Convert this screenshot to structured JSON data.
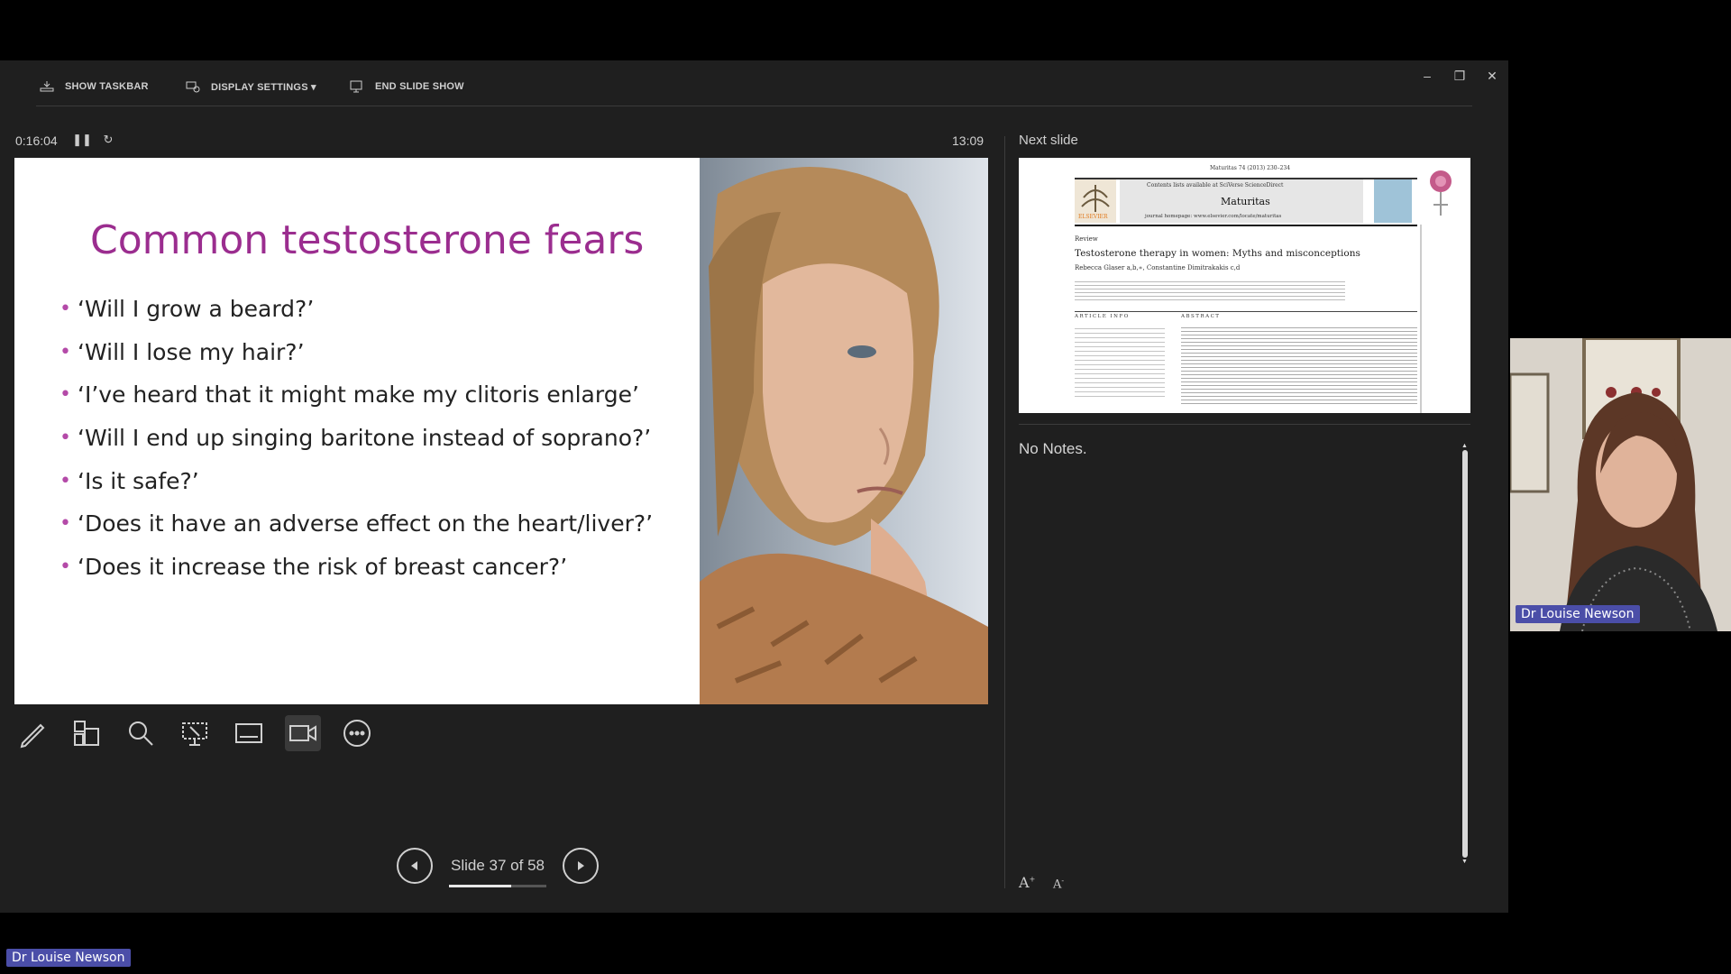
{
  "toolbar": {
    "show_taskbar": "SHOW TASKBAR",
    "display_settings": "DISPLAY SETTINGS ▾",
    "end_slide_show": "END SLIDE SHOW"
  },
  "window_controls": {
    "minimize": "–",
    "restore": "❐",
    "close": "✕"
  },
  "timer": {
    "elapsed": "0:16:04",
    "pause_icon": "pause-icon",
    "reset_icon": "reset-icon",
    "clock": "13:09"
  },
  "slide": {
    "title": "Common testosterone fears",
    "bullets": [
      "‘Will I grow a beard?’",
      "‘Will I lose my hair?’",
      "‘I’ve heard that it might make my clitoris enlarge’",
      "‘Will I end up singing baritone instead of soprano?’",
      "‘Is it safe?’",
      "‘Does it have an adverse effect on the heart/liver?’",
      "‘Does it increase the risk of breast cancer?’"
    ],
    "title_color": "#9b2d8f"
  },
  "next_slide": {
    "label": "Next slide",
    "journal": "Maturitas",
    "header_line": "Maturitas 74 (2013) 230–234",
    "contents_line": "Contents lists available at SciVerse ScienceDirect",
    "homepage_line": "journal homepage: www.elsevier.com/locate/maturitas",
    "publisher": "ELSEVIER",
    "section": "Review",
    "article_title": "Testosterone therapy in women: Myths and misconceptions",
    "authors": "Rebecca Glaser a,b,∗, Constantine Dimitrakakis c,d",
    "article_info": "ARTICLE INFO",
    "abstract": "ABSTRACT"
  },
  "notes": {
    "text": "No Notes."
  },
  "tools": [
    "pen-icon",
    "all-slides-icon",
    "zoom-icon",
    "laser-pointer-icon",
    "subtitles-icon",
    "camera-icon",
    "more-options-icon"
  ],
  "navigation": {
    "slide_text": "Slide 37 of 58",
    "current": 37,
    "total": 58
  },
  "font_controls": {
    "increase": "A",
    "decrease": "A"
  },
  "participants": {
    "video_name": "Dr Louise Newson",
    "bottom_name": "Dr Louise Newson"
  }
}
